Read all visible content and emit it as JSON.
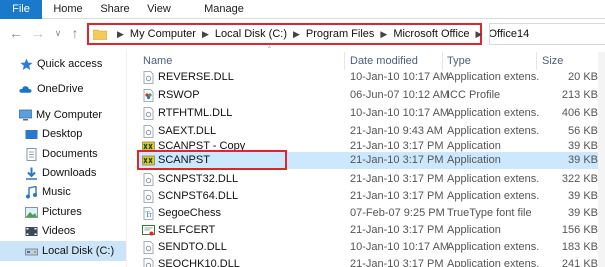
{
  "ribbon": {
    "tabs": [
      {
        "label": "File",
        "active": true
      },
      {
        "label": "Home"
      },
      {
        "label": "Share"
      },
      {
        "label": "View"
      },
      {
        "label": "Manage"
      }
    ]
  },
  "address": {
    "breadcrumbs": [
      "My Computer",
      "Local Disk (C:)",
      "Program Files",
      "Microsoft Office",
      "Office14"
    ]
  },
  "nav_pane": {
    "items": [
      {
        "label": "Quick access",
        "icon": "star-icon"
      },
      {
        "label": "OneDrive",
        "icon": "cloud-icon"
      },
      {
        "label": "My Computer",
        "icon": "computer-icon"
      },
      {
        "label": "Desktop",
        "icon": "desktop-icon"
      },
      {
        "label": "Documents",
        "icon": "documents-icon"
      },
      {
        "label": "Downloads",
        "icon": "downloads-icon"
      },
      {
        "label": "Music",
        "icon": "music-icon"
      },
      {
        "label": "Pictures",
        "icon": "pictures-icon"
      },
      {
        "label": "Videos",
        "icon": "videos-icon"
      },
      {
        "label": "Local Disk (C:)",
        "icon": "drive-icon",
        "selected": true
      }
    ]
  },
  "file_list": {
    "columns": [
      "Name",
      "Date modified",
      "Type",
      "Size"
    ],
    "rows": [
      {
        "name": "REVERSE.DLL",
        "date": "10-Jan-10 10:17 AM",
        "type": "Application extens...",
        "size": "20 KB",
        "icon": "dll-icon"
      },
      {
        "name": "RSWOP",
        "date": "06-Jun-07 10:12 AM",
        "type": "ICC Profile",
        "size": "213 KB",
        "icon": "icc-profile-icon"
      },
      {
        "name": "RTFHTML.DLL",
        "date": "10-Jan-10 10:17 AM",
        "type": "Application extens...",
        "size": "406 KB",
        "icon": "dll-icon"
      },
      {
        "name": "SAEXT.DLL",
        "date": "21-Jan-10 9:43 AM",
        "type": "Application extens...",
        "size": "56 KB",
        "icon": "dll-icon"
      },
      {
        "name": "SCANPST - Copy",
        "date": "21-Jan-10 3:17 PM",
        "type": "Application",
        "size": "39 KB",
        "icon": "scanpst-app-icon"
      },
      {
        "name": "SCANPST",
        "date": "21-Jan-10 3:17 PM",
        "type": "Application",
        "size": "39 KB",
        "icon": "scanpst-app-icon",
        "selected": true
      },
      {
        "name": "SCNPST32.DLL",
        "date": "21-Jan-10 3:17 PM",
        "type": "Application extens...",
        "size": "322 KB",
        "icon": "dll-icon"
      },
      {
        "name": "SCNPST64.DLL",
        "date": "21-Jan-10 3:17 PM",
        "type": "Application extens...",
        "size": "39 KB",
        "icon": "dll-icon"
      },
      {
        "name": "SegoeChess",
        "date": "07-Feb-07 9:25 PM",
        "type": "TrueType font file",
        "size": "39 KB",
        "icon": "font-icon"
      },
      {
        "name": "SELFCERT",
        "date": "21-Jan-10 3:17 PM",
        "type": "Application",
        "size": "156 KB",
        "icon": "certificate-app-icon"
      },
      {
        "name": "SENDTO.DLL",
        "date": "10-Jan-10 10:17 AM",
        "type": "Application extens...",
        "size": "183 KB",
        "icon": "dll-icon"
      },
      {
        "name": "SEQCHK10.DLL",
        "date": "21-Jan-10 3:17 PM",
        "type": "Application extens...",
        "size": "241 KB",
        "icon": "dll-icon"
      }
    ]
  },
  "colors": {
    "file_tab": "#1979ca",
    "highlight_red": "#e0262a",
    "selection_blue": "#cce8ff",
    "nav_selected": "#cce4f7",
    "header_text": "#4c607a"
  }
}
